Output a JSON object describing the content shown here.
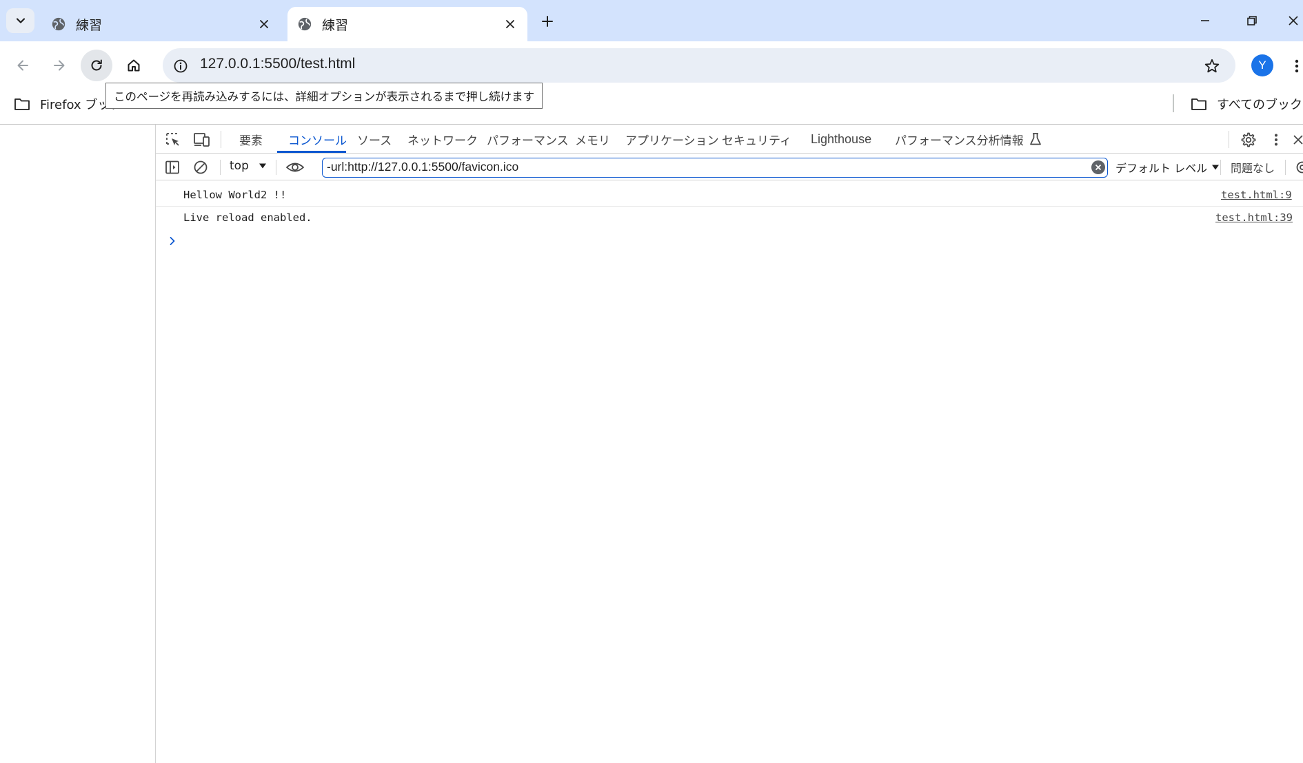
{
  "browser": {
    "tabs": [
      {
        "title": "練習",
        "active": false
      },
      {
        "title": "練習",
        "active": true
      }
    ],
    "address": {
      "url": "127.0.0.1:5500/test.html"
    },
    "profile_initial": "Y",
    "bookmarks": {
      "left_folder": "Firefox ブック",
      "right_folder": "すべてのブックマー"
    },
    "tooltip": "このページを再読み込みするには、詳細オプションが表示されるまで押し続けます",
    "colors": {
      "tabstrip": "#d3e3fd",
      "accent": "#0b57d0",
      "avatar": "#1a73e8"
    }
  },
  "devtools": {
    "tabs": [
      {
        "label": "要素"
      },
      {
        "label": "コンソール",
        "active": true
      },
      {
        "label": "ソース"
      },
      {
        "label": "ネットワーク"
      },
      {
        "label": "パフォーマンス"
      },
      {
        "label": "メモリ"
      },
      {
        "label": "アプリケーション"
      },
      {
        "label": "セキュリティ"
      },
      {
        "label": "Lighthouse"
      },
      {
        "label": "パフォーマンス分析情報"
      }
    ],
    "console": {
      "context": "top",
      "filter_value": "-url:http://127.0.0.1:5500/favicon.ico",
      "level": "デフォルト レベル",
      "issues": "問題なし",
      "messages": [
        {
          "text": "Hellow World2 !!",
          "source": "test.html:9"
        },
        {
          "text": "Live reload enabled.",
          "source": "test.html:39"
        }
      ]
    }
  }
}
